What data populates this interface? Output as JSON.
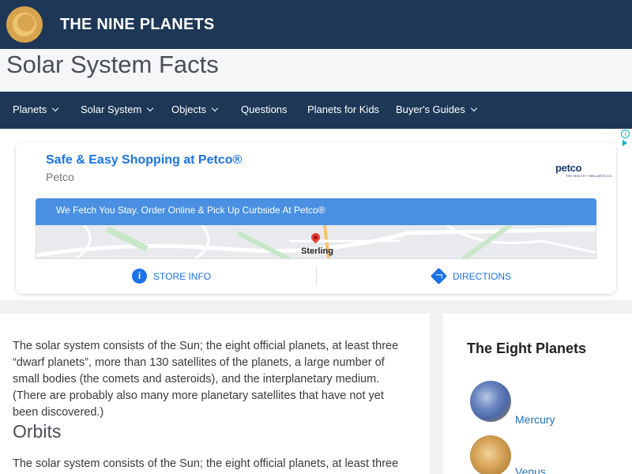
{
  "header": {
    "site_title": "THE NINE PLANETS"
  },
  "page_title": "Solar System Facts",
  "nav": {
    "items": [
      {
        "label": "Planets",
        "has_dropdown": true
      },
      {
        "label": "Solar System",
        "has_dropdown": true
      },
      {
        "label": "Objects",
        "has_dropdown": true
      },
      {
        "label": "Questions",
        "has_dropdown": false
      },
      {
        "label": "Planets for Kids",
        "has_dropdown": false
      },
      {
        "label": "Buyer's Guides",
        "has_dropdown": true
      }
    ]
  },
  "ad": {
    "headline": "Safe & Easy Shopping at Petco®",
    "advertiser": "Petco",
    "logo_text": "petco",
    "logo_subtext": "THE HEALTH + WELLNESS CO.",
    "banner": "We Fetch You Stay. Order Online & Pick Up Curbside At Petco®",
    "map_label": "Sterling",
    "store_info": "STORE INFO",
    "directions": "DIRECTIONS"
  },
  "content": {
    "intro": "The solar system consists of the Sun; the eight official planets, at least three “dwarf planets”, more than 130 satellites of the planets, a large number of small bodies (the comets and asteroids), and the interplanetary medium. (There are probably also many more planetary satellites that have not yet been discovered.)",
    "section_heading": "Orbits",
    "section_text": "The solar system consists of the Sun; the eight official planets, at least three"
  },
  "sidebar": {
    "title": "The Eight Planets",
    "planets": [
      {
        "name": "Mercury"
      },
      {
        "name": "Venus"
      }
    ]
  },
  "colors": {
    "nav_bg": "#1e3756",
    "link": "#1e6fb8",
    "ad_link": "#1a73e8"
  }
}
